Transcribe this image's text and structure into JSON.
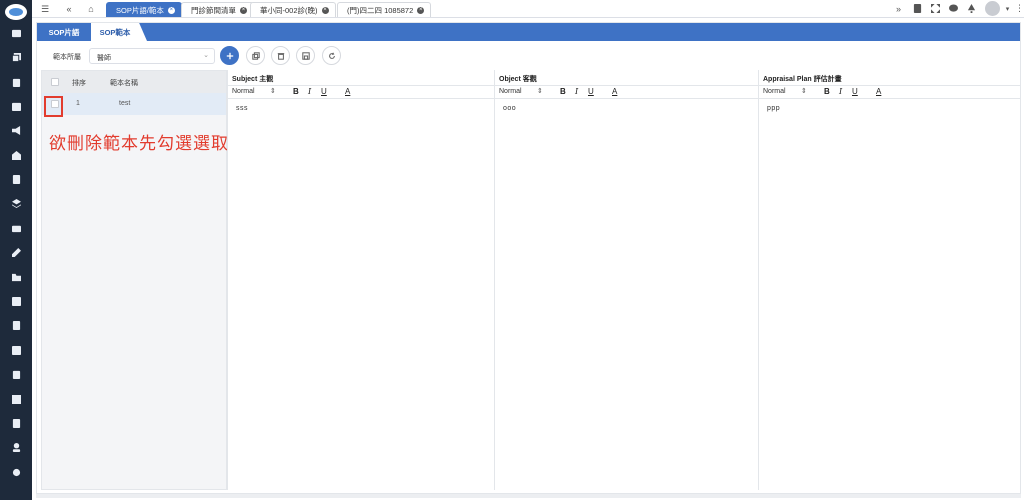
{
  "topbar": {
    "tabs": [
      {
        "label": "SOP片語/範本",
        "active": true
      },
      {
        "label": "門診節間清單",
        "active": false
      },
      {
        "label": "華小同-002診(晚)",
        "active": false
      },
      {
        "label": "(門)四二四 1085872",
        "active": false
      }
    ]
  },
  "subtabs": {
    "first": "SOP片語",
    "second": "SOP範本"
  },
  "toolbar": {
    "label": "範本所屬",
    "select_value": "醫師"
  },
  "list": {
    "headers": {
      "order": "排序",
      "name": "範本名稱"
    },
    "rows": [
      {
        "order": "1",
        "name": "test"
      }
    ]
  },
  "annotation": "欲刪除範本先勾選選取框",
  "editors": [
    {
      "title": "Subject 主觀",
      "format": "Normal",
      "content": "sss"
    },
    {
      "title": "Object 客觀",
      "format": "Normal",
      "content": "ooo"
    },
    {
      "title": "Appraisal Plan 評估計畫",
      "format": "Normal",
      "content": "ppp"
    }
  ],
  "colors": {
    "accent": "#3e72c5",
    "rail": "#1e2a3b",
    "annotation": "#e23c2e"
  }
}
